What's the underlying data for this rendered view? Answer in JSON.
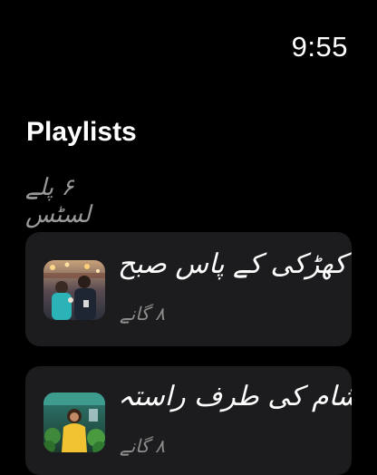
{
  "status_bar": {
    "time": "9:55"
  },
  "header": {
    "title": "Playlists",
    "count_label": "۶ پلے لسٹس"
  },
  "playlists": [
    {
      "title": "کھڑکی کے پاس صبح",
      "count": "۸ گانے",
      "thumbnail": "photo of two people talking at a night market"
    },
    {
      "title": "شام کی طرف راستہ",
      "count": "۸ گانے",
      "thumbnail": "photo of a woman at a plant stall"
    }
  ],
  "colors": {
    "background": "#000000",
    "card": "#1c1c1e",
    "secondary_text": "#8c8c8c"
  }
}
